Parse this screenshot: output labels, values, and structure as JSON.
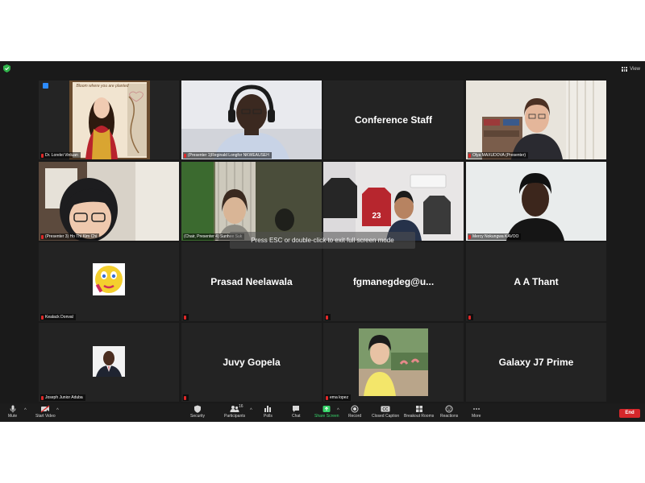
{
  "topbar": {
    "view_label": "View"
  },
  "tiles": [
    {
      "name": "Dr. Lorelei Vinluan",
      "big": "",
      "banner": "Bloom where you are planted"
    },
    {
      "name": "(Presenter 1)Reginald Longfor NKWEAUSEH",
      "big": ""
    },
    {
      "name": "",
      "big": "Conference Staff"
    },
    {
      "name": "Olya MAXUDOVA (Presenter)",
      "big": ""
    },
    {
      "name": "(Presenter 3) Ho Thi Kim Chi",
      "big": ""
    },
    {
      "name": "(Chair, Presenter 4) Sunhee Suk",
      "big": ""
    },
    {
      "name": "",
      "big": "",
      "shirt": "23"
    },
    {
      "name": "Mercy Nokungwa KAVOO",
      "big": ""
    },
    {
      "name": "Kealack Donval",
      "big": ""
    },
    {
      "name": "",
      "big": "Prasad Neelawala"
    },
    {
      "name": "",
      "big": "fgmanegdeg@u..."
    },
    {
      "name": "",
      "big": "A A Thant"
    },
    {
      "name": "Joseph Junior Aduba",
      "big": ""
    },
    {
      "name": "",
      "big": "Juvy Gopela"
    },
    {
      "name": "ema lopez",
      "big": ""
    },
    {
      "name": "",
      "big": "Galaxy J7 Prime"
    }
  ],
  "overlay": {
    "esc_message": "Press ESC or double-click to exit full screen mode"
  },
  "toolbar": {
    "mute": "Mute",
    "start_video": "Start Video",
    "security": "Security",
    "participants": "Participants",
    "participants_count": "16",
    "polls": "Polls",
    "chat": "Chat",
    "share_screen": "Share Screen",
    "record": "Record",
    "closed_caption": "Closed Caption",
    "breakout_rooms": "Breakout Rooms",
    "reactions": "Reactions",
    "more": "More",
    "end": "End"
  },
  "colors": {
    "speaker_outline": "#b6d33a",
    "share_green": "#37d36a",
    "end_red": "#d5272b"
  }
}
